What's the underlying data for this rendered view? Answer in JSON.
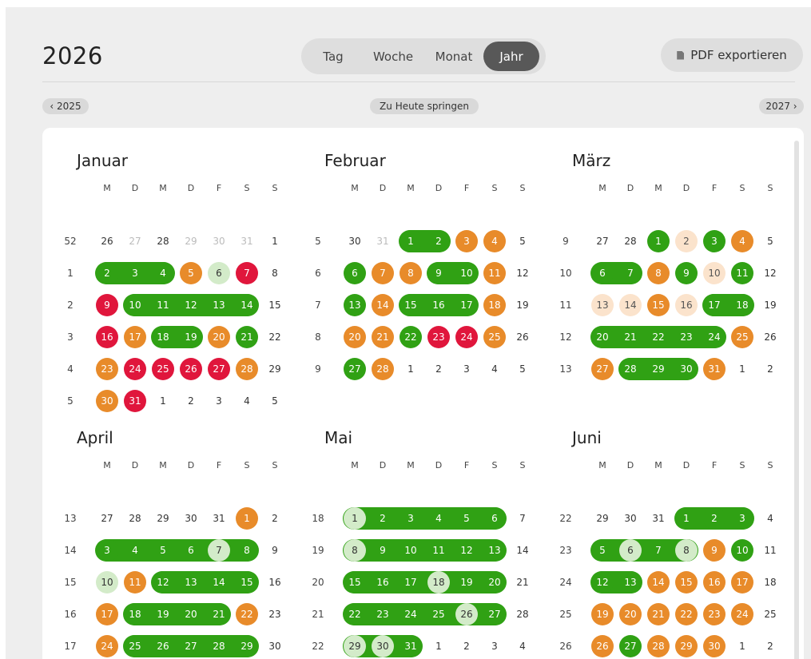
{
  "header": {
    "year": "2026",
    "views": [
      {
        "label": "Tag",
        "active": false
      },
      {
        "label": "Woche",
        "active": false
      },
      {
        "label": "Monat",
        "active": false
      },
      {
        "label": "Jahr",
        "active": true
      }
    ],
    "pdf_label": "PDF exportieren",
    "pdf_icon": "file-icon"
  },
  "nav": {
    "prev": "‹ 2025",
    "today": "Zu Heute springen",
    "next": "2027 ›"
  },
  "colors": {
    "g": "#30a114",
    "lg": "#d3ebc9",
    "o": "#e88b2a",
    "lo": "#fbe3cc",
    "r": "#e0163c",
    "text": "#333333",
    "muted": "#bbbbbb"
  },
  "weekday_labels": [
    "M",
    "D",
    "M",
    "D",
    "F",
    "S",
    "S"
  ],
  "months": [
    {
      "name": "Januar",
      "weeks": [
        {
          "kw": "52",
          "days": [
            [
              "26",
              "n"
            ],
            [
              "27",
              "m"
            ],
            [
              "28",
              "n"
            ],
            [
              "29",
              "m"
            ],
            [
              "30",
              "m"
            ],
            [
              "31",
              "m"
            ],
            [
              "1",
              "n"
            ]
          ]
        },
        {
          "kw": "1",
          "days": [
            [
              "2",
              "g"
            ],
            [
              "3",
              "g"
            ],
            [
              "4",
              "g"
            ],
            [
              "5",
              "o"
            ],
            [
              "6",
              "lg"
            ],
            [
              "7",
              "r"
            ],
            [
              "8",
              "n"
            ]
          ]
        },
        {
          "kw": "2",
          "days": [
            [
              "9",
              "r"
            ],
            [
              "10",
              "g"
            ],
            [
              "11",
              "g"
            ],
            [
              "12",
              "g"
            ],
            [
              "13",
              "g"
            ],
            [
              "14",
              "g"
            ],
            [
              "15",
              "n"
            ]
          ]
        },
        {
          "kw": "3",
          "days": [
            [
              "16",
              "r"
            ],
            [
              "17",
              "o"
            ],
            [
              "18",
              "g"
            ],
            [
              "19",
              "g"
            ],
            [
              "20",
              "o"
            ],
            [
              "21",
              "g"
            ],
            [
              "22",
              "n"
            ]
          ]
        },
        {
          "kw": "4",
          "days": [
            [
              "23",
              "o"
            ],
            [
              "24",
              "r"
            ],
            [
              "25",
              "r"
            ],
            [
              "26",
              "r"
            ],
            [
              "27",
              "r"
            ],
            [
              "28",
              "o"
            ],
            [
              "29",
              "n"
            ]
          ]
        },
        {
          "kw": "5",
          "days": [
            [
              "30",
              "o"
            ],
            [
              "31",
              "r"
            ],
            [
              "1",
              "n"
            ],
            [
              "2",
              "n"
            ],
            [
              "3",
              "n"
            ],
            [
              "4",
              "n"
            ],
            [
              "5",
              "n"
            ]
          ]
        }
      ]
    },
    {
      "name": "Februar",
      "weeks": [
        {
          "kw": "5",
          "days": [
            [
              "30",
              "n"
            ],
            [
              "31",
              "m"
            ],
            [
              "1",
              "g"
            ],
            [
              "2",
              "g"
            ],
            [
              "3",
              "o"
            ],
            [
              "4",
              "o"
            ],
            [
              "5",
              "n"
            ]
          ]
        },
        {
          "kw": "6",
          "days": [
            [
              "6",
              "g"
            ],
            [
              "7",
              "o"
            ],
            [
              "8",
              "o"
            ],
            [
              "9",
              "g"
            ],
            [
              "10",
              "g"
            ],
            [
              "11",
              "o"
            ],
            [
              "12",
              "n"
            ]
          ]
        },
        {
          "kw": "7",
          "days": [
            [
              "13",
              "g"
            ],
            [
              "14",
              "o"
            ],
            [
              "15",
              "g"
            ],
            [
              "16",
              "g"
            ],
            [
              "17",
              "g"
            ],
            [
              "18",
              "o"
            ],
            [
              "19",
              "n"
            ]
          ]
        },
        {
          "kw": "8",
          "days": [
            [
              "20",
              "o"
            ],
            [
              "21",
              "o"
            ],
            [
              "22",
              "g"
            ],
            [
              "23",
              "r"
            ],
            [
              "24",
              "r"
            ],
            [
              "25",
              "o"
            ],
            [
              "26",
              "n"
            ]
          ]
        },
        {
          "kw": "9",
          "days": [
            [
              "27",
              "g"
            ],
            [
              "28",
              "o"
            ],
            [
              "1",
              "n"
            ],
            [
              "2",
              "n"
            ],
            [
              "3",
              "n"
            ],
            [
              "4",
              "n"
            ],
            [
              "5",
              "n"
            ]
          ]
        }
      ]
    },
    {
      "name": "März",
      "weeks": [
        {
          "kw": "9",
          "days": [
            [
              "27",
              "n"
            ],
            [
              "28",
              "n"
            ],
            [
              "1",
              "g"
            ],
            [
              "2",
              "lo"
            ],
            [
              "3",
              "g"
            ],
            [
              "4",
              "o"
            ],
            [
              "5",
              "n"
            ]
          ]
        },
        {
          "kw": "10",
          "days": [
            [
              "6",
              "g"
            ],
            [
              "7",
              "g"
            ],
            [
              "8",
              "o"
            ],
            [
              "9",
              "g"
            ],
            [
              "10",
              "lo"
            ],
            [
              "11",
              "g"
            ],
            [
              "12",
              "n"
            ]
          ]
        },
        {
          "kw": "11",
          "days": [
            [
              "13",
              "lo"
            ],
            [
              "14",
              "lo"
            ],
            [
              "15",
              "o"
            ],
            [
              "16",
              "lo"
            ],
            [
              "17",
              "g"
            ],
            [
              "18",
              "g"
            ],
            [
              "19",
              "n"
            ]
          ]
        },
        {
          "kw": "12",
          "days": [
            [
              "20",
              "g"
            ],
            [
              "21",
              "g"
            ],
            [
              "22",
              "g"
            ],
            [
              "23",
              "g"
            ],
            [
              "24",
              "g"
            ],
            [
              "25",
              "o"
            ],
            [
              "26",
              "n"
            ]
          ]
        },
        {
          "kw": "13",
          "days": [
            [
              "27",
              "o"
            ],
            [
              "28",
              "g"
            ],
            [
              "29",
              "g"
            ],
            [
              "30",
              "g"
            ],
            [
              "31",
              "o"
            ],
            [
              "1",
              "n"
            ],
            [
              "2",
              "n"
            ]
          ]
        }
      ]
    },
    {
      "name": "April",
      "weeks": [
        {
          "kw": "13",
          "days": [
            [
              "27",
              "n"
            ],
            [
              "28",
              "n"
            ],
            [
              "29",
              "n"
            ],
            [
              "30",
              "n"
            ],
            [
              "31",
              "n"
            ],
            [
              "1",
              "o"
            ],
            [
              "2",
              "n"
            ]
          ]
        },
        {
          "kw": "14",
          "days": [
            [
              "3",
              "g"
            ],
            [
              "4",
              "g"
            ],
            [
              "5",
              "g"
            ],
            [
              "6",
              "g"
            ],
            [
              "7",
              "lg"
            ],
            [
              "8",
              "g"
            ],
            [
              "9",
              "n"
            ]
          ]
        },
        {
          "kw": "15",
          "days": [
            [
              "10",
              "lg"
            ],
            [
              "11",
              "o"
            ],
            [
              "12",
              "g"
            ],
            [
              "13",
              "g"
            ],
            [
              "14",
              "g"
            ],
            [
              "15",
              "g"
            ],
            [
              "16",
              "n"
            ]
          ]
        },
        {
          "kw": "16",
          "days": [
            [
              "17",
              "o"
            ],
            [
              "18",
              "g"
            ],
            [
              "19",
              "g"
            ],
            [
              "20",
              "g"
            ],
            [
              "21",
              "g"
            ],
            [
              "22",
              "o"
            ],
            [
              "23",
              "n"
            ]
          ]
        },
        {
          "kw": "17",
          "days": [
            [
              "24",
              "o"
            ],
            [
              "25",
              "g"
            ],
            [
              "26",
              "g"
            ],
            [
              "27",
              "g"
            ],
            [
              "28",
              "g"
            ],
            [
              "29",
              "g"
            ],
            [
              "30",
              "n"
            ]
          ]
        }
      ]
    },
    {
      "name": "Mai",
      "weeks": [
        {
          "kw": "18",
          "days": [
            [
              "1",
              "lg"
            ],
            [
              "2",
              "g"
            ],
            [
              "3",
              "g"
            ],
            [
              "4",
              "g"
            ],
            [
              "5",
              "g"
            ],
            [
              "6",
              "g"
            ],
            [
              "7",
              "n"
            ]
          ]
        },
        {
          "kw": "19",
          "days": [
            [
              "8",
              "lg"
            ],
            [
              "9",
              "g"
            ],
            [
              "10",
              "g"
            ],
            [
              "11",
              "g"
            ],
            [
              "12",
              "g"
            ],
            [
              "13",
              "g"
            ],
            [
              "14",
              "n"
            ]
          ]
        },
        {
          "kw": "20",
          "days": [
            [
              "15",
              "g"
            ],
            [
              "16",
              "g"
            ],
            [
              "17",
              "g"
            ],
            [
              "18",
              "lg"
            ],
            [
              "19",
              "g"
            ],
            [
              "20",
              "g"
            ],
            [
              "21",
              "n"
            ]
          ]
        },
        {
          "kw": "21",
          "days": [
            [
              "22",
              "g"
            ],
            [
              "23",
              "g"
            ],
            [
              "24",
              "g"
            ],
            [
              "25",
              "g"
            ],
            [
              "26",
              "lg"
            ],
            [
              "27",
              "g"
            ],
            [
              "28",
              "n"
            ]
          ]
        },
        {
          "kw": "22",
          "days": [
            [
              "29",
              "lg"
            ],
            [
              "30",
              "lg"
            ],
            [
              "31",
              "g"
            ],
            [
              "1",
              "n"
            ],
            [
              "2",
              "n"
            ],
            [
              "3",
              "n"
            ],
            [
              "4",
              "n"
            ]
          ]
        }
      ]
    },
    {
      "name": "Juni",
      "weeks": [
        {
          "kw": "22",
          "days": [
            [
              "29",
              "n"
            ],
            [
              "30",
              "n"
            ],
            [
              "31",
              "n"
            ],
            [
              "1",
              "g"
            ],
            [
              "2",
              "g"
            ],
            [
              "3",
              "g"
            ],
            [
              "4",
              "n"
            ]
          ]
        },
        {
          "kw": "23",
          "days": [
            [
              "5",
              "g"
            ],
            [
              "6",
              "lg"
            ],
            [
              "7",
              "g"
            ],
            [
              "8",
              "lg"
            ],
            [
              "9",
              "o"
            ],
            [
              "10",
              "g"
            ],
            [
              "11",
              "n"
            ]
          ]
        },
        {
          "kw": "24",
          "days": [
            [
              "12",
              "g"
            ],
            [
              "13",
              "g"
            ],
            [
              "14",
              "o"
            ],
            [
              "15",
              "o"
            ],
            [
              "16",
              "o"
            ],
            [
              "17",
              "o"
            ],
            [
              "18",
              "n"
            ]
          ]
        },
        {
          "kw": "25",
          "days": [
            [
              "19",
              "o"
            ],
            [
              "20",
              "o"
            ],
            [
              "21",
              "o"
            ],
            [
              "22",
              "o"
            ],
            [
              "23",
              "o"
            ],
            [
              "24",
              "o"
            ],
            [
              "25",
              "n"
            ]
          ]
        },
        {
          "kw": "26",
          "days": [
            [
              "26",
              "o"
            ],
            [
              "27",
              "g"
            ],
            [
              "28",
              "o"
            ],
            [
              "29",
              "o"
            ],
            [
              "30",
              "o"
            ],
            [
              "1",
              "n"
            ],
            [
              "2",
              "n"
            ]
          ]
        }
      ]
    }
  ]
}
